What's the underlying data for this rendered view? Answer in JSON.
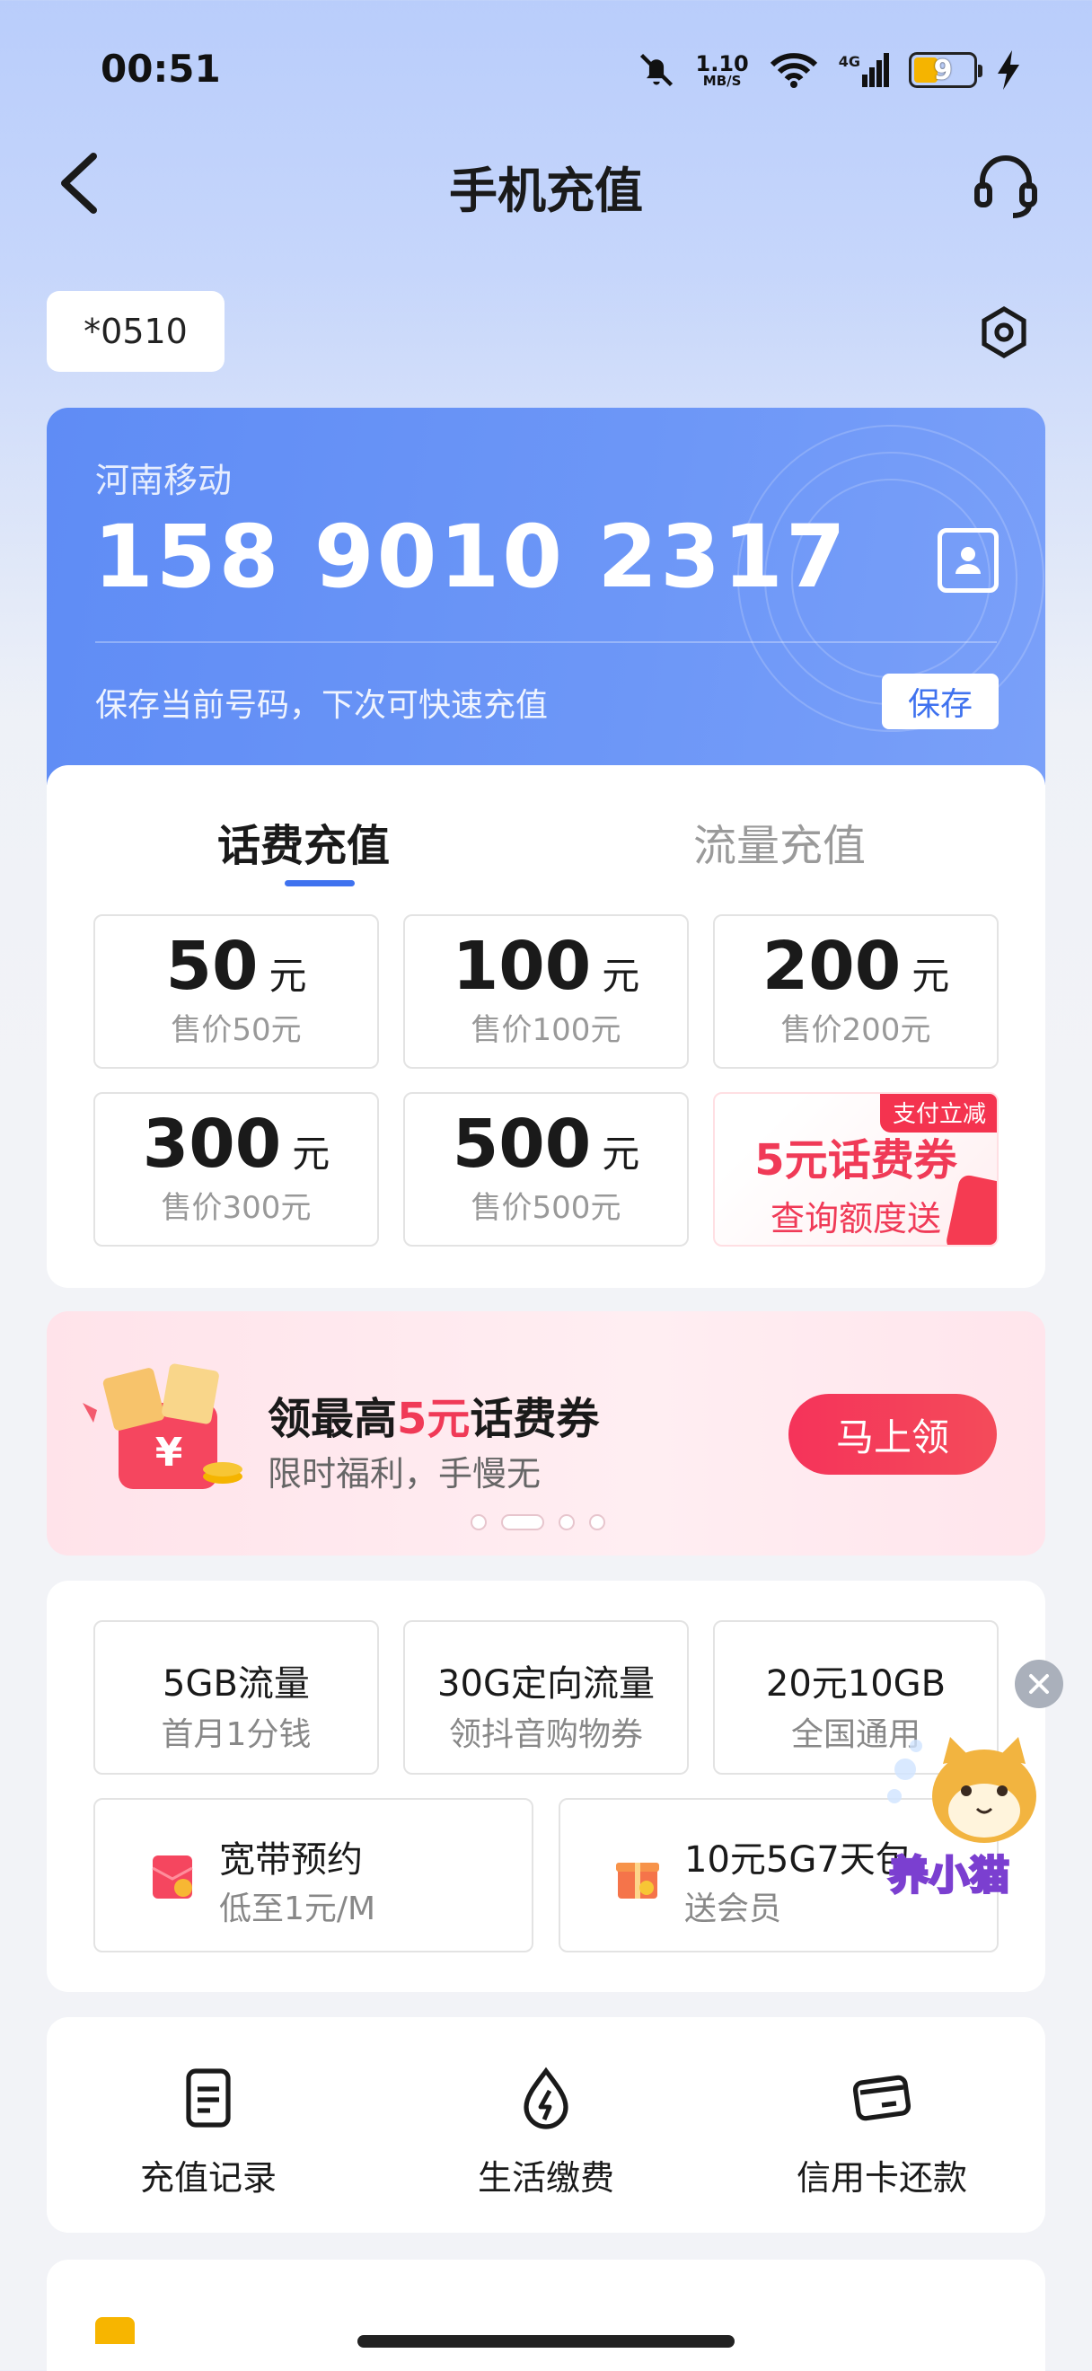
{
  "status_bar": {
    "time": "00:51",
    "net_speed": "1.10",
    "net_unit": "MB/S",
    "network": "4G",
    "battery": "9"
  },
  "nav": {
    "title": "手机充值"
  },
  "account": {
    "label": "*0510"
  },
  "card": {
    "carrier": "河南移动",
    "phone_number": "158 9010 2317",
    "save_hint": "保存当前号码，下次可快速充值",
    "save_label": "保存"
  },
  "tabs": [
    {
      "label": "话费充值",
      "active": true
    },
    {
      "label": "流量充值",
      "active": false
    }
  ],
  "amounts": [
    {
      "value": "50",
      "unit": "元",
      "price": "售价50元"
    },
    {
      "value": "100",
      "unit": "元",
      "price": "售价100元"
    },
    {
      "value": "200",
      "unit": "元",
      "price": "售价200元"
    },
    {
      "value": "300",
      "unit": "元",
      "price": "售价300元"
    },
    {
      "value": "500",
      "unit": "元",
      "price": "售价500元"
    }
  ],
  "coupon_cell": {
    "tag": "支付立减",
    "title": "5元话费券",
    "subtitle": "查询额度送"
  },
  "promo": {
    "title_pre": "领最高",
    "title_hl": "5元",
    "title_post": "话费券",
    "subtitle": "限时福利，手慢无",
    "button": "马上领",
    "accent": "#f03a57"
  },
  "packages": [
    {
      "title": "5GB流量",
      "subtitle": "首月1分钱"
    },
    {
      "title": "30G定向流量",
      "subtitle": "领抖音购物券"
    },
    {
      "title": "20元10GB",
      "subtitle": "全国通用"
    }
  ],
  "packages_wide": [
    {
      "title": "宽带预约",
      "subtitle": "低至1元/M",
      "icon": "red-envelope-icon"
    },
    {
      "title": "10元5G7天包",
      "subtitle": "送会员",
      "icon": "gift-box-icon"
    }
  ],
  "mascot": {
    "label": "养小猫"
  },
  "services": [
    {
      "label": "充值记录",
      "icon": "document-icon"
    },
    {
      "label": "生活缴费",
      "icon": "lightning-drop-icon"
    },
    {
      "label": "信用卡还款",
      "icon": "credit-card-icon"
    }
  ],
  "colors": {
    "primary": "#3f72ef",
    "card": "#6d97f7",
    "accent": "#f03a57"
  }
}
